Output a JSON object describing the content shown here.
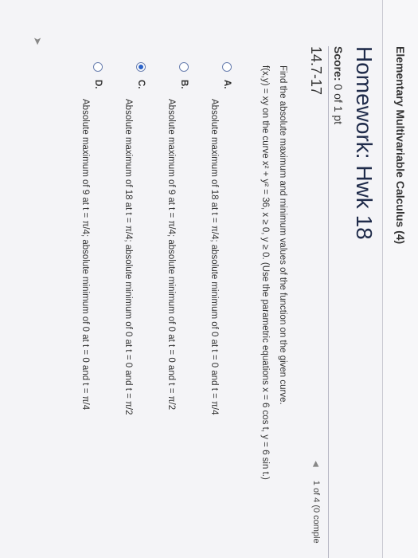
{
  "course": {
    "title": "Elementary Multivariable Calculus (4)"
  },
  "homework": {
    "title": "Homework: Hwk 18"
  },
  "score": {
    "label": "Score:",
    "value": "0 of 1 pt"
  },
  "question": {
    "id": "14.7-17",
    "nav": "1 of 4 (0 comple",
    "prompt": "Find the absolute maximum and minimum values of the function on the given curve.",
    "detail": "f(x,y) = xy on the curve x² + y² = 36, x ≥ 0, y ≥ 0. (Use the parametric equations x = 6 cos t, y = 6 sin t.)"
  },
  "options": [
    {
      "letter": "A.",
      "text": "Absolute maximum of 18 at t = π/4; absolute minimum of 0 at t = 0 and t = π/4",
      "selected": false
    },
    {
      "letter": "B.",
      "text": "Absolute maximum of 9 at t = π/4; absolute minimum of 0 at t = 0 and t = π/2",
      "selected": false
    },
    {
      "letter": "C.",
      "text": "Absolute maximum of 18 at t = π/4; absolute minimum of 0 at t = 0 and t = π/2",
      "selected": true
    },
    {
      "letter": "D.",
      "text": "Absolute maximum of 9 at t = π/4; absolute minimum of 0 at t = 0 and t = π/4",
      "selected": false
    }
  ]
}
